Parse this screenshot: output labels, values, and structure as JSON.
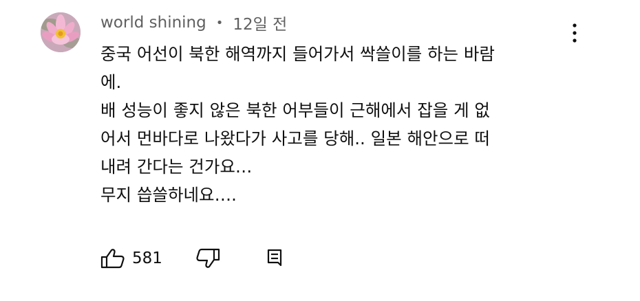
{
  "comment": {
    "author": "world shining",
    "separator": "•",
    "time": "12일 전",
    "lines": [
      "중국 어선이 북한 해역까지 들어가서 싹쓸이를 하는 바람",
      "에.",
      "배 성능이 좋지 않은 북한 어부들이 근해에서 잡을 게 없",
      "어서  먼바다로 나왔다가 사고를 당해.. 일본 해안으로 떠",
      "내려 간다는 건가요…",
      "무지 씁쓸하네요…."
    ],
    "like_count": "581"
  },
  "icons": {
    "avatar": "lotus-flower-avatar",
    "menu": "more-vert-icon",
    "like": "thumb-up-icon",
    "dislike": "thumb-down-icon",
    "reply": "reply-comment-icon"
  },
  "colors": {
    "text": "#0f0f0f",
    "secondary": "#606060",
    "background": "#ffffff"
  }
}
